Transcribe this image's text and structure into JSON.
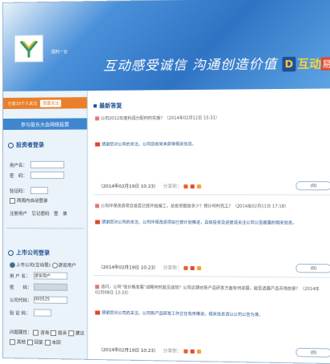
{
  "header": {
    "logo_caption": "国利一合",
    "slogan": "互动感受诚信 沟通创造价值",
    "brand_text": "互动",
    "brand_sub": "易"
  },
  "sidebar": {
    "member_label": "已有10个人关注",
    "member_button": "我要关注",
    "join_label": "参与股东大会网络投票",
    "investor_login_title": "投资者登录",
    "username_label": "用户名：",
    "password_label": "密　码：",
    "captcha_label": "验证码：",
    "remember_label": "两周内自动登录",
    "register_links": "注册用户　忘记密码　登　录",
    "company_login_title": "上市公司登录",
    "role_options": [
      "上市公司(互动易)",
      "游览用户"
    ],
    "company_user_label": "用 户 名：",
    "company_user_value": "游览用户",
    "company_pwd_label": "密　　码：",
    "company_code_label": "公司代码：",
    "company_code_value": "000525",
    "company_captcha_label": "验 证 码：",
    "filter_label": "问题属性：",
    "filter_options": [
      "咨询",
      "投诉",
      "建议"
    ],
    "filter_options_2": [
      "其他",
      "回复",
      "未回"
    ]
  },
  "main": {
    "title": "最新答复",
    "items": [
      {
        "question": "公司2012年度利润分配何时实施？（2014年02月12日 15:31）",
        "answer": "感谢您对公司的关注。公司目前尚未获得相关信息。",
        "meta": "（2014年02月19日 10:23）",
        "share": "分享到：",
        "button": "(0)"
      },
      {
        "question": "公司环保改造项目是否已经开始施工，总投资额是多少？预计何时完工？（2014年02月11日 17:18）",
        "answer": "感谢您对公司的关注。公司环保改造项目已按计划推进，具体投资及进度请关注公司公告披露的相关信息。",
        "meta": "（2014年02月19日 10:23）",
        "share": "分享到：",
        "button": "(0)"
      },
      {
        "question": "请问，公司“低价格发展”战略何时能见成效？公司近期在新产品研发方面有何进展，能否透露产品市场前景？（2014年02月08日 13:33）",
        "answer": "感谢您对公司的关注。公司新产品研发工作正在有序推进，相关信息请以公司公告为准。",
        "meta": "（2014年02月19日 10:23）",
        "share": "分享到：",
        "button": "(0)"
      }
    ]
  },
  "colors": {
    "banner": "#2f74c4",
    "accent": "#e97f2a",
    "title": "#1f4f8e"
  }
}
